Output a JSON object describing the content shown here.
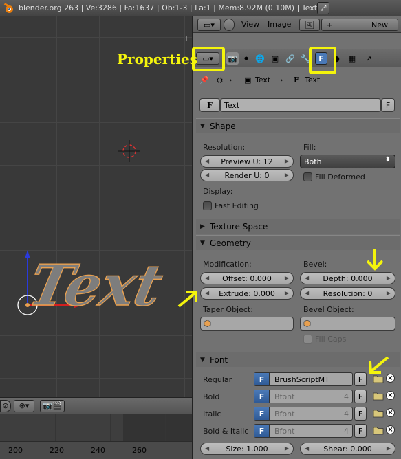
{
  "info_bar": {
    "text": "blender.org 263 | Ve:3286 | Fa:1637 | Ob:1-3 | La:1 | Mem:8.92M (0.10M) | Text"
  },
  "viewport": {
    "text_object_label": "Text"
  },
  "timeline": {
    "frames": [
      "200",
      "220",
      "240",
      "260"
    ]
  },
  "editor_header": {
    "menus": [
      "View",
      "Image"
    ],
    "new_button": "New"
  },
  "properties": {
    "annotation_label": "Properties",
    "breadcrumb": [
      "Text",
      "Text"
    ],
    "datablock_name": "Text",
    "datablock_fake_user": "F",
    "shape": {
      "title": "Shape",
      "resolution_label": "Resolution:",
      "preview_u": "Preview U: 12",
      "render_u": "Render U: 0",
      "fill_label": "Fill:",
      "fill_value": "Both",
      "fill_deformed": "Fill Deformed",
      "display_label": "Display:",
      "fast_editing": "Fast Editing"
    },
    "texture_space": {
      "title": "Texture Space"
    },
    "geometry": {
      "title": "Geometry",
      "modification_label": "Modification:",
      "offset": "Offset: 0.000",
      "extrude": "Extrude: 0.000",
      "bevel_label": "Bevel:",
      "depth": "Depth: 0.000",
      "resolution": "Resolution: 0",
      "taper_label": "Taper Object:",
      "bevel_object_label": "Bevel Object:",
      "fill_caps": "Fill Caps"
    },
    "font": {
      "title": "Font",
      "rows": [
        {
          "label": "Regular",
          "name": "BrushScriptMT",
          "count": "",
          "f": "F"
        },
        {
          "label": "Bold",
          "name": "Bfont",
          "count": "4",
          "f": "F"
        },
        {
          "label": "Italic",
          "name": "Bfont",
          "count": "4",
          "f": "F"
        },
        {
          "label": "Bold & Italic",
          "name": "Bfont",
          "count": "4",
          "f": "F"
        }
      ],
      "size": "Size: 1.000",
      "shear": "Shear: 0.000"
    }
  },
  "colors": {
    "annotation": "#f4f40c",
    "object_outline": "#e8a050",
    "active_tab": "#4a79b7"
  }
}
